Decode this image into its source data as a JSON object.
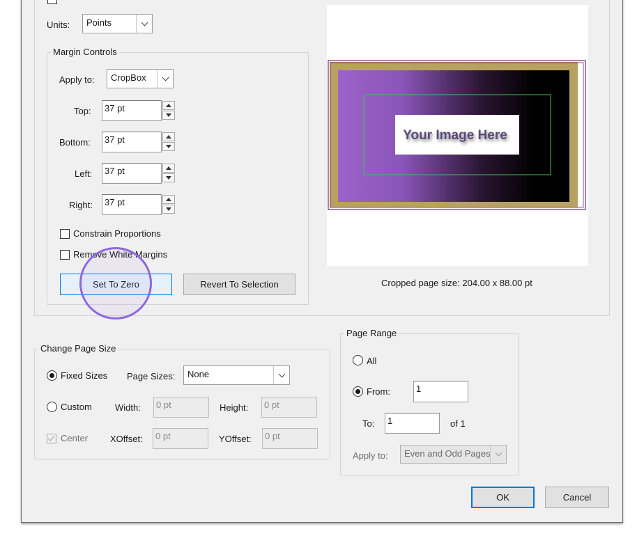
{
  "units": {
    "label": "Units:",
    "value": "Points"
  },
  "margin_controls": {
    "title": "Margin Controls",
    "apply_to_label": "Apply to:",
    "apply_to_value": "CropBox",
    "top": {
      "label": "Top:",
      "value": "37 pt"
    },
    "bottom": {
      "label": "Bottom:",
      "value": "37 pt"
    },
    "left": {
      "label": "Left:",
      "value": "37 pt"
    },
    "right": {
      "label": "Right:",
      "value": "37 pt"
    },
    "constrain_proportions": {
      "label": "Constrain Proportions",
      "checked": false
    },
    "remove_white_margins": {
      "label": "Remove White Margins",
      "checked": false
    },
    "set_to_zero_label": "Set To Zero",
    "revert_to_selection_label": "Revert To Selection"
  },
  "preview": {
    "placeholder_text": "Your Image Here",
    "cropped_size_text": "Cropped page size: 204.00 x 88.00 pt",
    "colors": {
      "frame_gold": "#b7a262",
      "gradient_start": "#9b63c9",
      "gradient_end": "#000000",
      "crop_outline": "#7a2a6d",
      "inner_outline": "#3fbf5a"
    }
  },
  "change_page_size": {
    "title": "Change Page Size",
    "fixed_sizes_label": "Fixed Sizes",
    "fixed_sizes_selected": true,
    "page_sizes_label": "Page Sizes:",
    "page_sizes_value": "None",
    "custom_label": "Custom",
    "width_label": "Width:",
    "width_value": "0 pt",
    "height_label": "Height:",
    "height_value": "0 pt",
    "center_label": "Center",
    "center_checked": true,
    "xoffset_label": "XOffset:",
    "xoffset_value": "0 pt",
    "yoffset_label": "YOffset:",
    "yoffset_value": "0 pt"
  },
  "page_range": {
    "title": "Page Range",
    "all_label": "All",
    "from_label": "From:",
    "from_selected": true,
    "from_value": "1",
    "to_label": "To:",
    "to_value": "1",
    "of_text": "of 1",
    "apply_to_label": "Apply to:",
    "apply_to_value": "Even and Odd Pages"
  },
  "buttons": {
    "ok": "OK",
    "cancel": "Cancel"
  },
  "accent_color": "#0078d7",
  "highlight_color": "#8f67e0"
}
